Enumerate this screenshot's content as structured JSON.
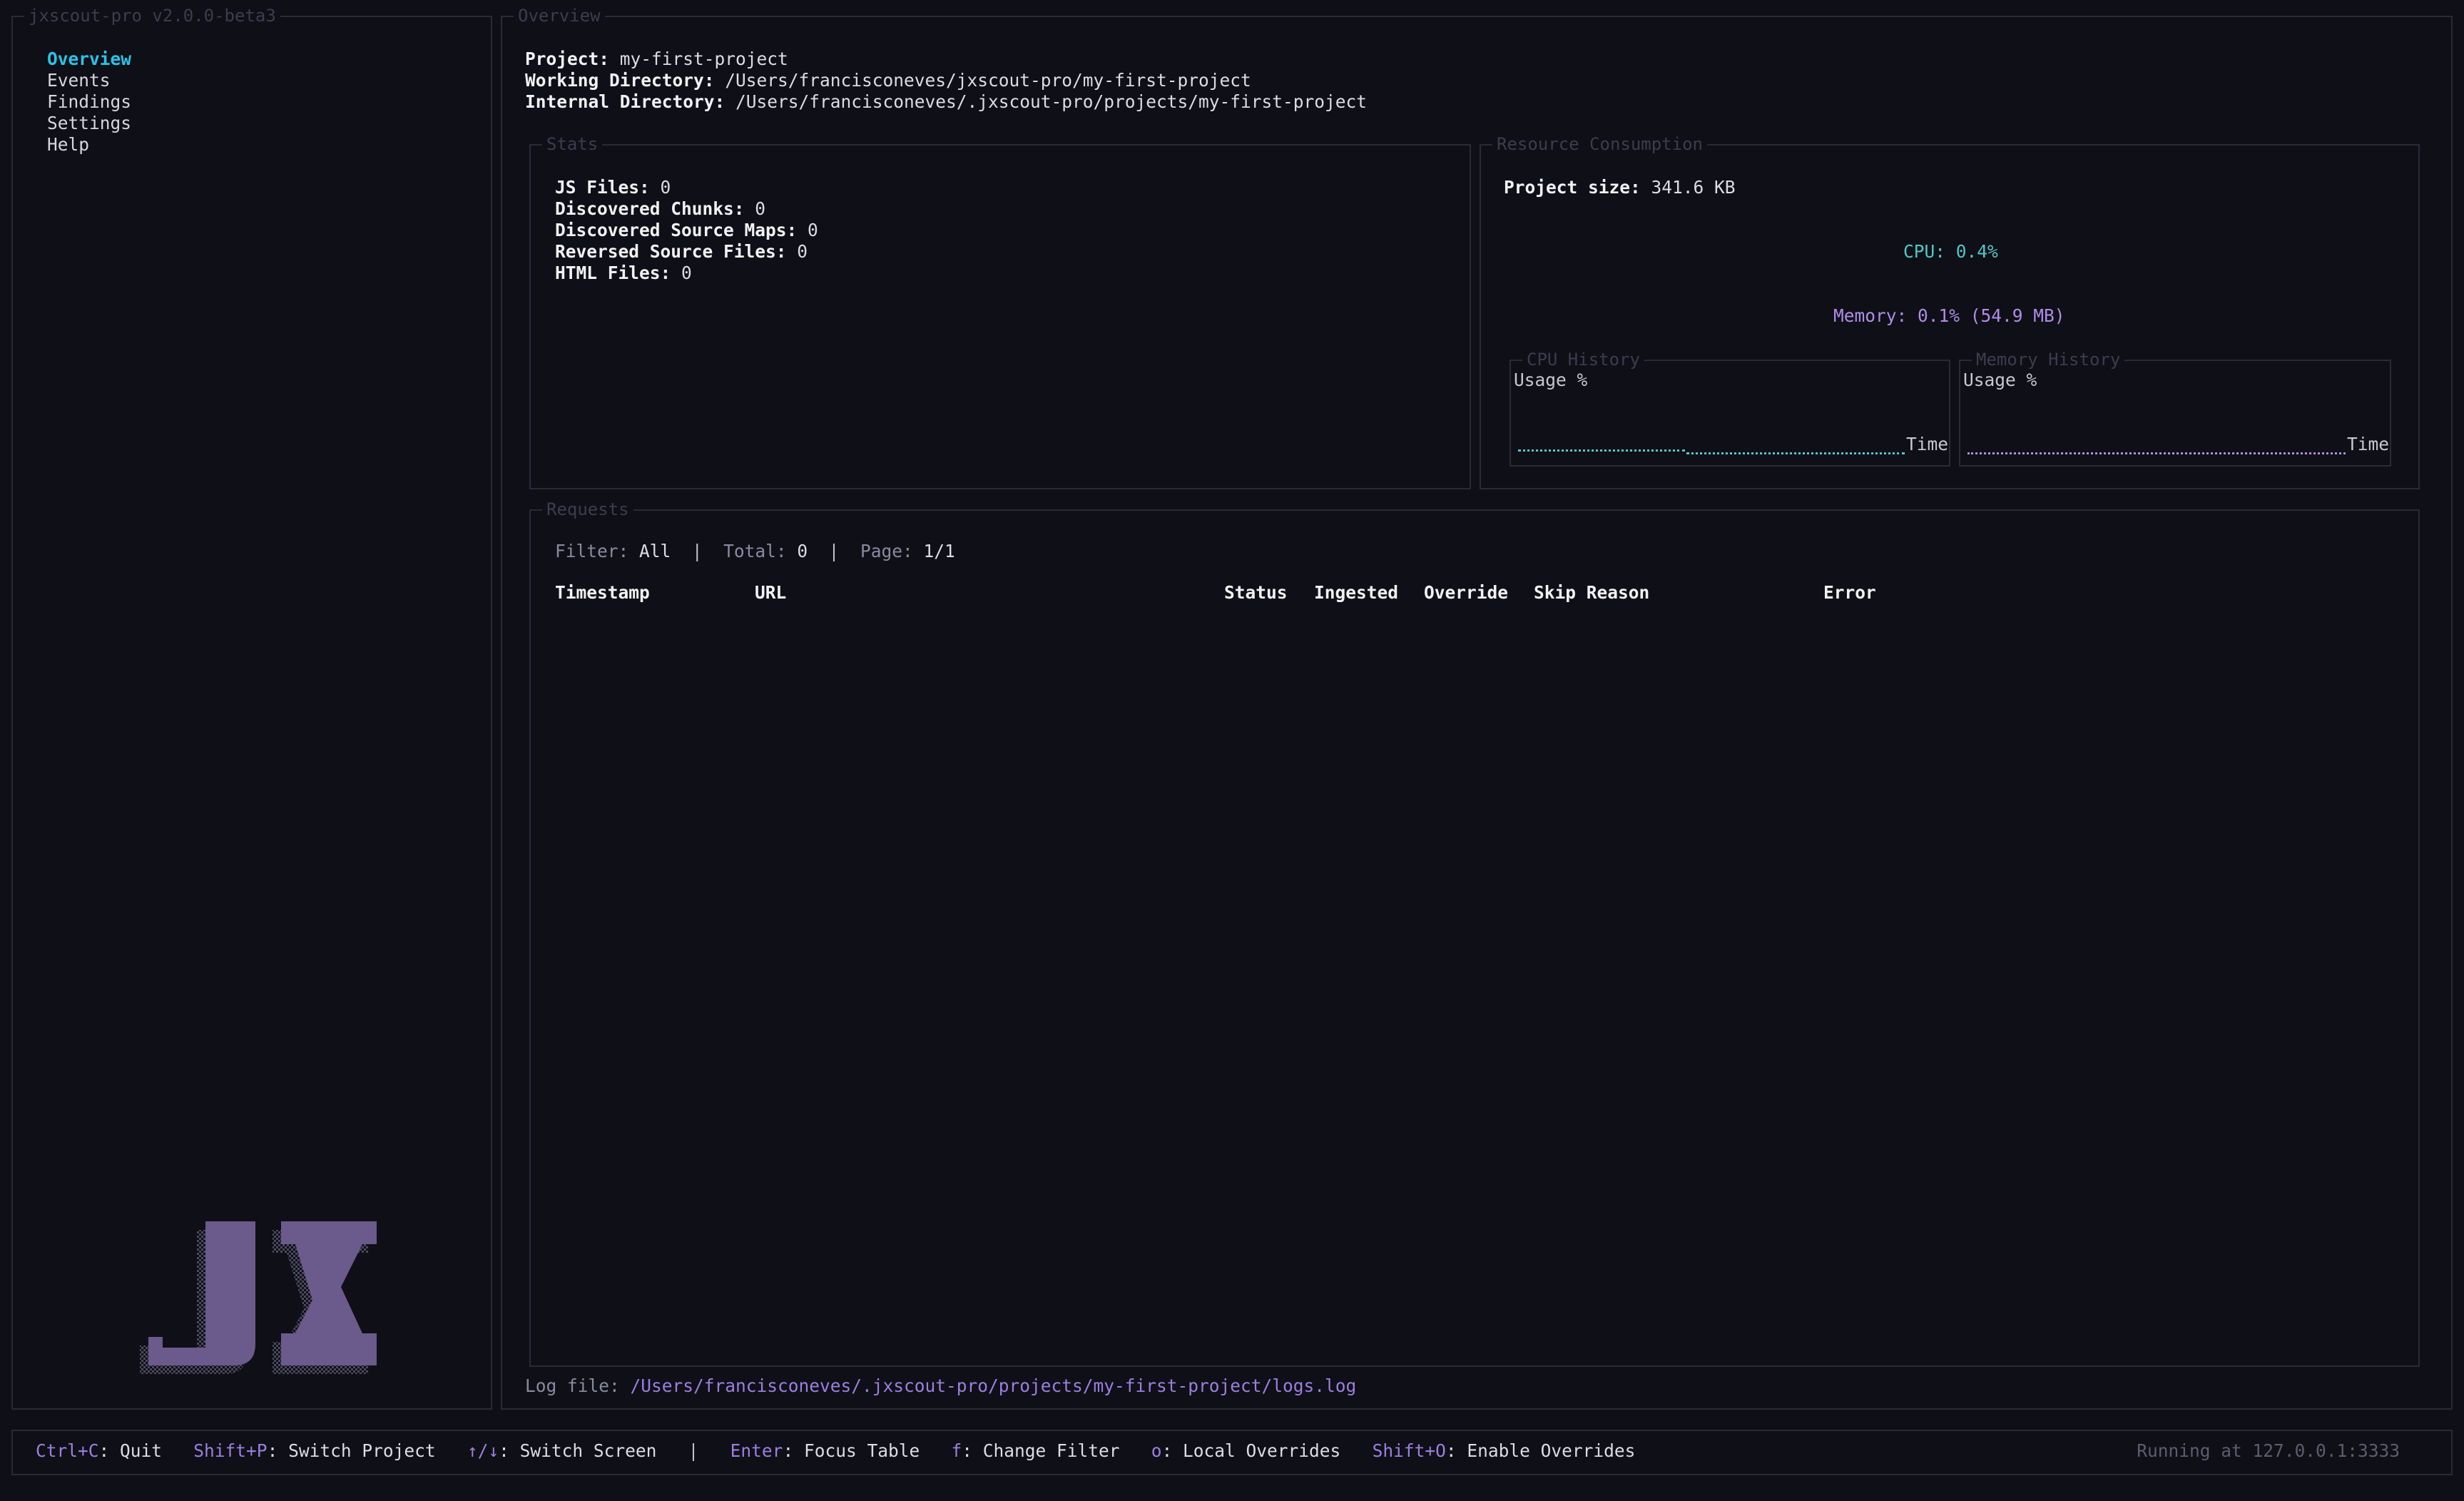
{
  "sidebar": {
    "title": "jxscout-pro v2.0.0-beta3",
    "items": [
      {
        "label": "Overview",
        "active": true
      },
      {
        "label": "Events"
      },
      {
        "label": "Findings"
      },
      {
        "label": "Settings"
      },
      {
        "label": "Help"
      }
    ],
    "logo_text": "JX"
  },
  "main": {
    "title": "Overview",
    "project": {
      "label": "Project:",
      "value": "my-first-project"
    },
    "working_dir": {
      "label": "Working Directory:",
      "value": "/Users/francisconeves/jxscout-pro/my-first-project"
    },
    "internal_dir": {
      "label": "Internal Directory:",
      "value": "/Users/francisconeves/.jxscout-pro/projects/my-first-project"
    }
  },
  "stats": {
    "title": "Stats",
    "rows": [
      {
        "label": "JS Files:",
        "value": "0"
      },
      {
        "label": "Discovered Chunks:",
        "value": "0"
      },
      {
        "label": "Discovered Source Maps:",
        "value": "0"
      },
      {
        "label": "Reversed Source Files:",
        "value": "0"
      },
      {
        "label": "HTML Files:",
        "value": "0"
      }
    ]
  },
  "resources": {
    "title": "Resource Consumption",
    "project_size": {
      "label": "Project size:",
      "value": "341.6 KB"
    },
    "cpu": "CPU: 0.4%",
    "memory": "Memory: 0.1% (54.9 MB)",
    "cpu_history": {
      "title": "CPU History",
      "ylabel": "Usage %",
      "xlabel": "Time"
    },
    "memory_history": {
      "title": "Memory History",
      "ylabel": "Usage %",
      "xlabel": "Time"
    }
  },
  "requests": {
    "title": "Requests",
    "filter_label": "Filter:",
    "filter_value": "All",
    "total_label": "Total:",
    "total_value": "0",
    "page_label": "Page:",
    "page_value": "1/1",
    "separator": "|",
    "columns": [
      "Timestamp",
      "URL",
      "Status",
      "Ingested",
      "Override",
      "Skip Reason",
      "Error"
    ]
  },
  "log": {
    "label": "Log file:",
    "path": "/Users/francisconeves/.jxscout-pro/projects/my-first-project/logs.log"
  },
  "footer": {
    "shortcuts": [
      {
        "key": "Ctrl+C",
        "action": ": Quit"
      },
      {
        "key": "Shift+P",
        "action": ": Switch Project"
      },
      {
        "key": "↑/↓",
        "action": ": Switch Screen"
      },
      {
        "key": "Enter",
        "action": ": Focus Table"
      },
      {
        "key": "f",
        "action": ": Change Filter"
      },
      {
        "key": "o",
        "action": ": Local Overrides"
      },
      {
        "key": "Shift+O",
        "action": ": Enable Overrides"
      }
    ],
    "separator": "|",
    "status": "Running at 127.0.0.1:3333"
  },
  "colors": {
    "background": "#0f0f17",
    "border": "#2a2a3a",
    "accent_active": "#28c4e8",
    "cpu": "#4ec8c8",
    "memory": "#b08ce8",
    "shortcut_key": "#9c7fe0",
    "logo": "#6b5a8c"
  }
}
